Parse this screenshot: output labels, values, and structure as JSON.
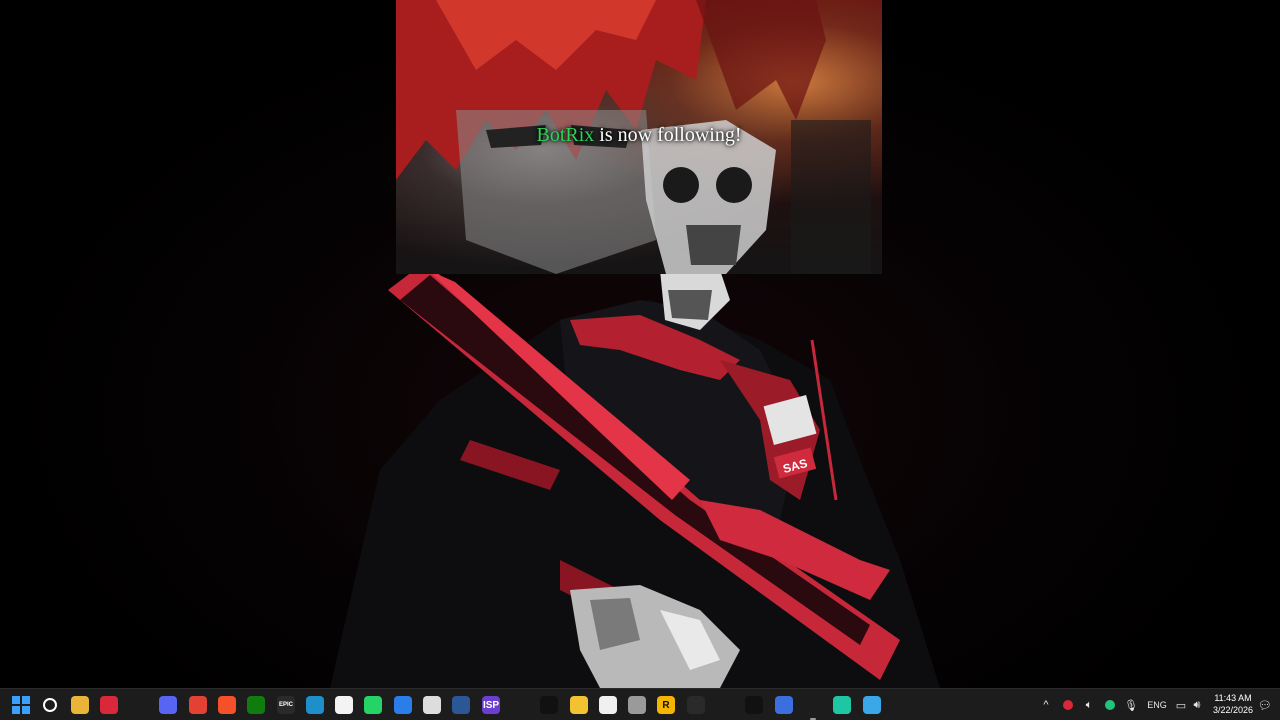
{
  "alert": {
    "username": "BotRix",
    "message": " is now following!"
  },
  "wallpaper": {
    "patch_letters": "SAS"
  },
  "taskbar": {
    "icons": [
      {
        "name": "windows-start-icon",
        "glyph": "",
        "bg": "#1c1c1c",
        "color": "#3aa0ff"
      },
      {
        "name": "search-icon",
        "glyph": "",
        "bg": "#1c1c1c",
        "color": "#ffffff"
      },
      {
        "name": "file-explorer-icon",
        "glyph": "",
        "bg": "#e8b53a",
        "color": "#ffffff"
      },
      {
        "name": "app-red-icon",
        "glyph": "",
        "bg": "#d9283a",
        "color": "#ffffff"
      },
      {
        "name": "steam-icon",
        "glyph": "",
        "bg": "#1c1c1c",
        "color": "#dfe6ee"
      },
      {
        "name": "discord-icon",
        "glyph": "",
        "bg": "#5865f2",
        "color": "#ffffff"
      },
      {
        "name": "chrome-icon",
        "glyph": "",
        "bg": "#e34133",
        "color": "#ffffff"
      },
      {
        "name": "brave-icon",
        "glyph": "",
        "bg": "#f4502a",
        "color": "#ffffff"
      },
      {
        "name": "xbox-icon",
        "glyph": "",
        "bg": "#107c10",
        "color": "#ffffff"
      },
      {
        "name": "epic-games-icon",
        "glyph": "EPIC",
        "bg": "#2a2a2a",
        "color": "#ffffff"
      },
      {
        "name": "edge-icon",
        "glyph": "",
        "bg": "#1e8fc9",
        "color": "#ffffff"
      },
      {
        "name": "microsoft-store-icon",
        "glyph": "",
        "bg": "#f3f3f3",
        "color": "#333333"
      },
      {
        "name": "whatsapp-icon",
        "glyph": "",
        "bg": "#25d366",
        "color": "#ffffff"
      },
      {
        "name": "app-blue-circle-icon",
        "glyph": "",
        "bg": "#2b7de9",
        "color": "#ffffff"
      },
      {
        "name": "obs-icon",
        "glyph": "",
        "bg": "#dddddd",
        "color": "#222222"
      },
      {
        "name": "word-icon",
        "glyph": "",
        "bg": "#2b5797",
        "color": "#ffffff"
      },
      {
        "name": "isp-icon",
        "glyph": "ISP",
        "bg": "#6a3fd0",
        "color": "#ffffff"
      },
      {
        "name": "app-gold-icon",
        "glyph": "",
        "bg": "#1c1c1c",
        "color": "#e0a020"
      },
      {
        "name": "app-black-icon",
        "glyph": "",
        "bg": "#111111",
        "color": "#ffffff"
      },
      {
        "name": "app-yellow-icon",
        "glyph": "",
        "bg": "#f2c230",
        "color": "#111111"
      },
      {
        "name": "app-white-cube-icon",
        "glyph": "",
        "bg": "#f0f0f0",
        "color": "#333333"
      },
      {
        "name": "app-gray-stack-icon",
        "glyph": "",
        "bg": "#9a9a9a",
        "color": "#ffffff"
      },
      {
        "name": "rockstar-icon",
        "glyph": "R",
        "bg": "#f5b400",
        "color": "#111111"
      },
      {
        "name": "unity-icon",
        "glyph": "",
        "bg": "#2a2a2a",
        "color": "#ffffff"
      },
      {
        "name": "app-gold-wing-icon",
        "glyph": "",
        "bg": "#1c1c1c",
        "color": "#f2b01e"
      },
      {
        "name": "capcut-icon",
        "glyph": "",
        "bg": "#111111",
        "color": "#ffffff"
      },
      {
        "name": "app-white-square-icon",
        "glyph": "",
        "bg": "#3b6fe0",
        "color": "#ffffff"
      },
      {
        "name": "app-circle-outline-icon",
        "glyph": "",
        "bg": "#1c1c1c",
        "color": "#ffffff"
      },
      {
        "name": "app-teal-icon",
        "glyph": "",
        "bg": "#1ec6a4",
        "color": "#ffffff"
      },
      {
        "name": "app-light-blue-icon",
        "glyph": "",
        "bg": "#3aa8e8",
        "color": "#ffffff"
      }
    ],
    "tray": {
      "language": "ENG",
      "time": "11:43 AM",
      "date": "3/22/2026"
    }
  }
}
